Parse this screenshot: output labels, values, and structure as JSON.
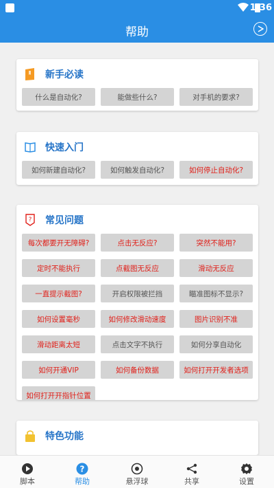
{
  "status": {
    "time": "1:36"
  },
  "appbar": {
    "title": "帮助"
  },
  "sections": [
    {
      "title": "新手必读",
      "icon": "orange-book-icon",
      "items": [
        {
          "label": "什么是自动化?",
          "red": false
        },
        {
          "label": "能做些什么?",
          "red": false
        },
        {
          "label": "对手机的要求?",
          "red": false
        }
      ]
    },
    {
      "title": "快速入门",
      "icon": "open-book-icon",
      "items": [
        {
          "label": "如何新建自动化?",
          "red": false
        },
        {
          "label": "如何触发自动化?",
          "red": false
        },
        {
          "label": "如何停止自动化?",
          "red": true
        }
      ]
    },
    {
      "title": "常见问题",
      "icon": "question-doc-icon",
      "items": [
        {
          "label": "每次都要开无障碍?",
          "red": true
        },
        {
          "label": "点击无反应?",
          "red": true
        },
        {
          "label": "突然不能用?",
          "red": true
        },
        {
          "label": "定时不能执行",
          "red": true
        },
        {
          "label": "点截图无反应",
          "red": true
        },
        {
          "label": "滑动无反应",
          "red": true
        },
        {
          "label": "一直提示截图?",
          "red": true
        },
        {
          "label": "开启权限被拦挡",
          "red": false
        },
        {
          "label": "瞄准图标不显示?",
          "red": false
        },
        {
          "label": "如何设置毫秒",
          "red": true
        },
        {
          "label": "如何修改滑动速度",
          "red": true
        },
        {
          "label": "图片识别不准",
          "red": true
        },
        {
          "label": "滑动距离太短",
          "red": true
        },
        {
          "label": "点击文字不执行",
          "red": false
        },
        {
          "label": "如何分享自动化",
          "red": false
        },
        {
          "label": "如何开通VIP",
          "red": true
        },
        {
          "label": "如何备份数据",
          "red": true
        },
        {
          "label": "如何打开开发者选项",
          "red": true
        },
        {
          "label": "如何打开开指针位置",
          "red": true
        }
      ]
    },
    {
      "title": "特色功能",
      "icon": "lock-badge-icon",
      "items": []
    }
  ],
  "tabs": [
    {
      "label": "脚本",
      "icon": "play-circle-icon",
      "active": false
    },
    {
      "label": "帮助",
      "icon": "help-circle-icon",
      "active": true
    },
    {
      "label": "悬浮球",
      "icon": "floating-ball-icon",
      "active": false
    },
    {
      "label": "共享",
      "icon": "share-icon",
      "active": false
    },
    {
      "label": "设置",
      "icon": "gear-icon",
      "active": false
    }
  ],
  "colors": {
    "primary": "#2a8ee4",
    "section_title": "#2775c8",
    "alert_text": "#e0201a"
  }
}
